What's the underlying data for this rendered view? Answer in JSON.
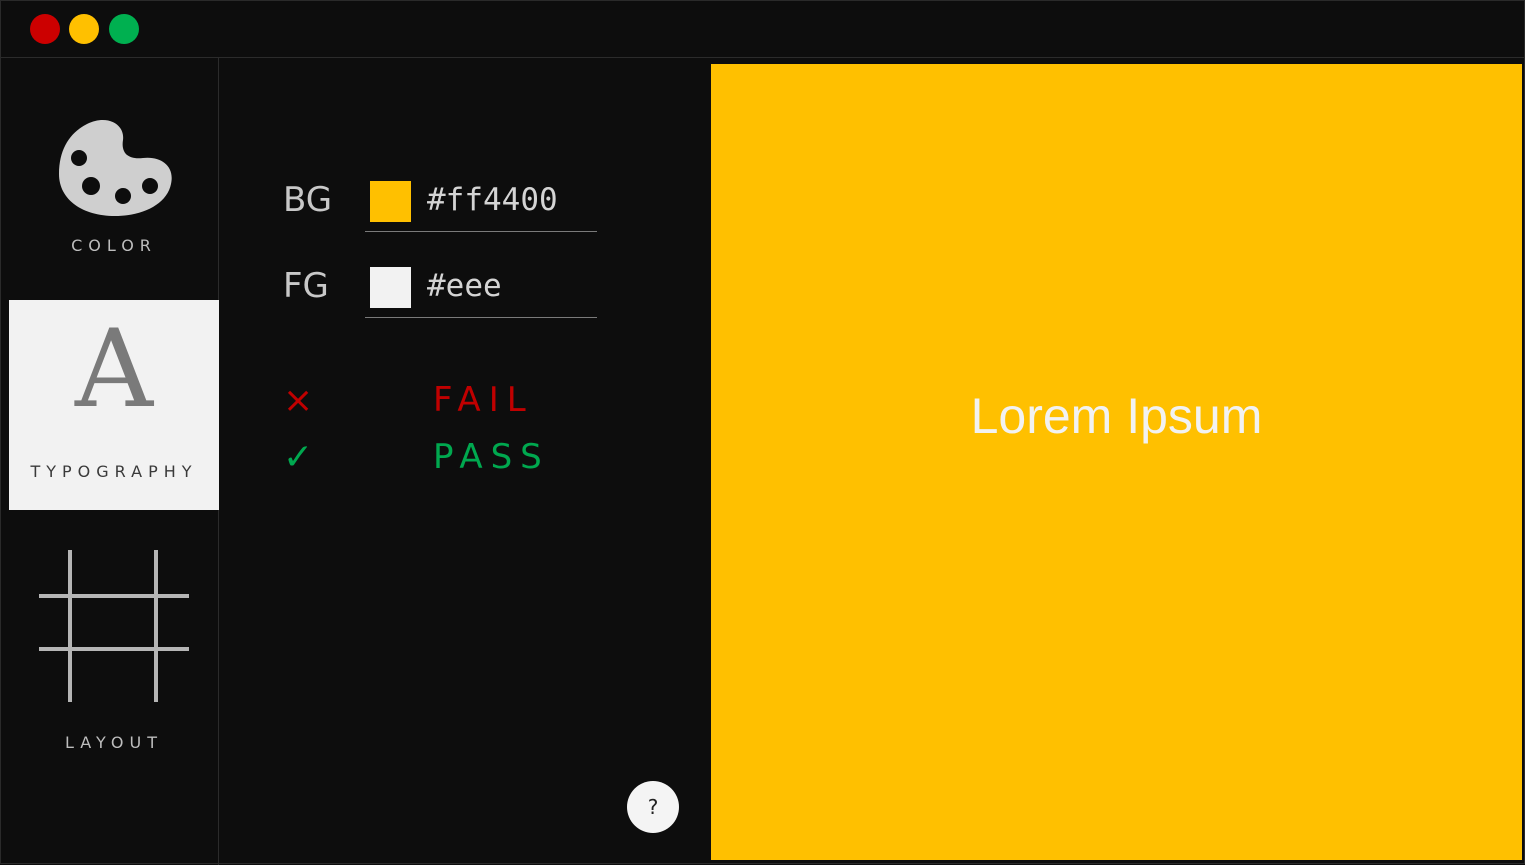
{
  "window": {
    "controls": [
      {
        "name": "close",
        "color": "#cc0000"
      },
      {
        "name": "minimize",
        "color": "#ffc000"
      },
      {
        "name": "maximize",
        "color": "#00b050"
      }
    ]
  },
  "sidebar": {
    "items": [
      {
        "label": "COLOR",
        "icon": "palette-icon",
        "active": false
      },
      {
        "label": "TYPOGRAPHY",
        "icon": "typography-icon",
        "glyph": "A",
        "active": true
      },
      {
        "label": "LAYOUT",
        "icon": "grid-icon",
        "active": false
      }
    ]
  },
  "controls": {
    "bg": {
      "label": "BG",
      "value": "#ff4400",
      "swatch_color": "#ffc000"
    },
    "fg": {
      "label": "FG",
      "value": "#eee",
      "swatch_color": "#f2f2f2"
    }
  },
  "results": [
    {
      "status": "fail",
      "icon": "cross-icon",
      "symbol": "×",
      "text": "FAIL",
      "color": "#c00000"
    },
    {
      "status": "pass",
      "icon": "check-icon",
      "symbol": "✓",
      "text": "PASS",
      "color": "#00a84f"
    }
  ],
  "help": {
    "label": "?"
  },
  "preview": {
    "text": "Lorem Ipsum",
    "background": "#ffc000",
    "foreground": "#f2f2f2"
  }
}
